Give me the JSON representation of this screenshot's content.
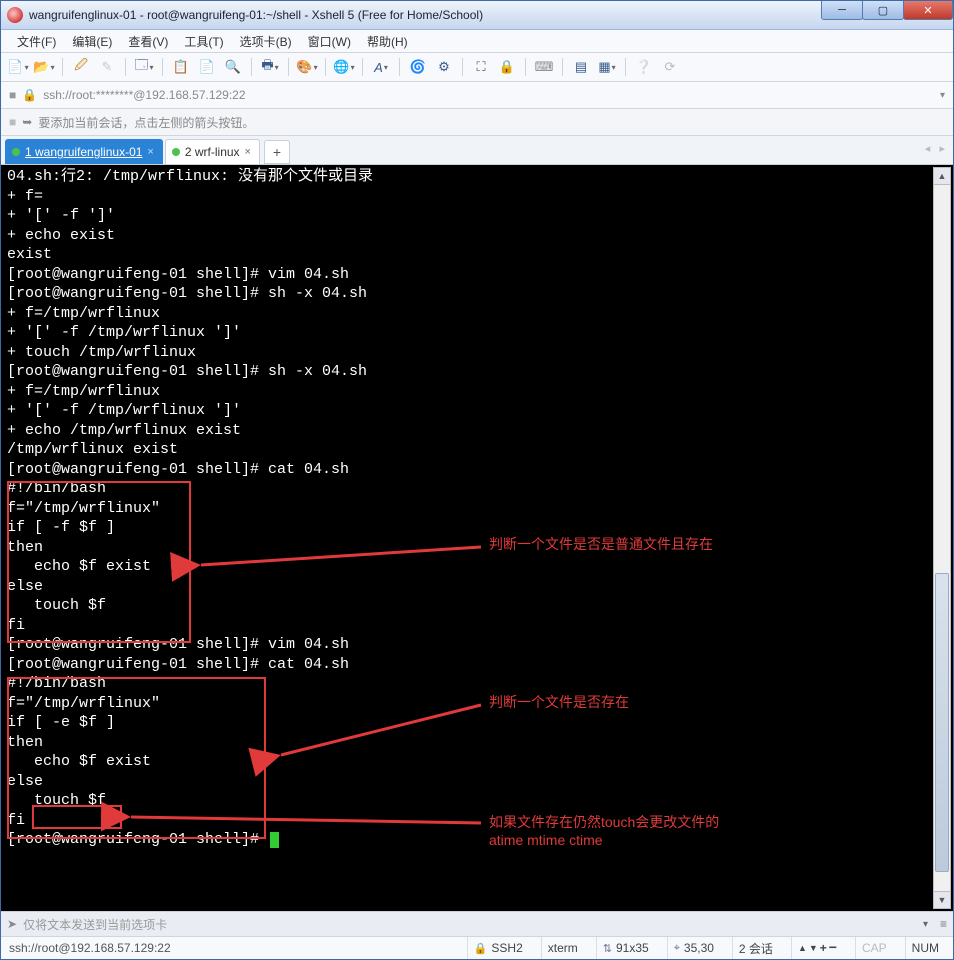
{
  "window": {
    "title": "wangruifenglinux-01 - root@wangruifeng-01:~/shell - Xshell 5 (Free for Home/School)"
  },
  "menu": {
    "file": "文件(F)",
    "edit": "编辑(E)",
    "view": "查看(V)",
    "tools": "工具(T)",
    "tabs": "选项卡(B)",
    "window": "窗口(W)",
    "help": "帮助(H)"
  },
  "address": {
    "text": "ssh://root:********@192.168.57.129:22"
  },
  "hint": {
    "text": "要添加当前会话，点击左侧的箭头按钮。"
  },
  "tabs": {
    "t1": {
      "label": "1 wangruifenglinux-01"
    },
    "t2": {
      "label": "2 wrf-linux"
    }
  },
  "terminal": {
    "lines": "04.sh:行2: /tmp/wrflinux: 没有那个文件或目录\n+ f=\n+ '[' -f ']'\n+ echo exist\nexist\n[root@wangruifeng-01 shell]# vim 04.sh\n[root@wangruifeng-01 shell]# sh -x 04.sh\n+ f=/tmp/wrflinux\n+ '[' -f /tmp/wrflinux ']'\n+ touch /tmp/wrflinux\n[root@wangruifeng-01 shell]# sh -x 04.sh\n+ f=/tmp/wrflinux\n+ '[' -f /tmp/wrflinux ']'\n+ echo /tmp/wrflinux exist\n/tmp/wrflinux exist\n[root@wangruifeng-01 shell]# cat 04.sh\n#!/bin/bash\nf=\"/tmp/wrflinux\"\nif [ -f $f ]\nthen\n   echo $f exist\nelse\n   touch $f\nfi\n[root@wangruifeng-01 shell]# vim 04.sh\n[root@wangruifeng-01 shell]# cat 04.sh\n#!/bin/bash\nf=\"/tmp/wrflinux\"\nif [ -e $f ]\nthen\n   echo $f exist\nelse\n   touch $f\nfi\n[root@wangruifeng-01 shell]# "
  },
  "annotations": {
    "a1": "判断一个文件是否是普通文件且存在",
    "a2": "判断一个文件是否存在",
    "a3": "如果文件存在仍然touch会更改文件的\natime mtime ctime"
  },
  "sendbar": {
    "placeholder": "仅将文本发送到当前选项卡"
  },
  "status": {
    "ssh_url": "ssh://root@192.168.57.129:22",
    "protocol": "SSH2",
    "term": "xterm",
    "size": "91x35",
    "cursor": "35,30",
    "sessions": "2 会话",
    "cap": "CAP",
    "num": "NUM"
  }
}
